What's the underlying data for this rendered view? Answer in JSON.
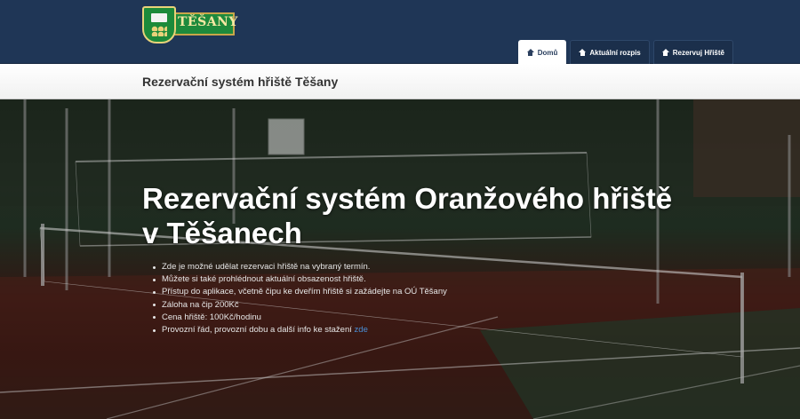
{
  "brand": {
    "logo_text": "TĚŠANY"
  },
  "nav": {
    "tabs": [
      {
        "label": "Domů",
        "icon": "home-icon",
        "active": true
      },
      {
        "label": "Aktuální rozpis",
        "icon": "home-icon",
        "active": false
      },
      {
        "label": "Rezervuj Hřiště",
        "icon": "home-icon",
        "active": false
      }
    ]
  },
  "header": {
    "title": "Rezervační systém hřiště Těšany"
  },
  "hero": {
    "title_line1": "Rezervační systém Oranžového hřiště",
    "title_line2": "v Těšanech",
    "bullets": [
      "Zde je možné udělat rezervaci hřiště na vybraný termín.",
      "Můžete si také prohlédnout aktuální obsazenost hřiště.",
      "Přístup do aplikace, včetně čipu ke dveřím hřiště si zažádejte na OÚ Těšany",
      "Záloha na čip 200Kč",
      "Cena hřiště: 100Kč/hodinu"
    ],
    "last_bullet_text": "Provozní řád, provozní dobu a další info ke stažení",
    "last_bullet_link": "zde"
  },
  "colors": {
    "navbar": "#1f3656",
    "link": "#4a8fd8",
    "logo_green": "#1e8a3c"
  }
}
